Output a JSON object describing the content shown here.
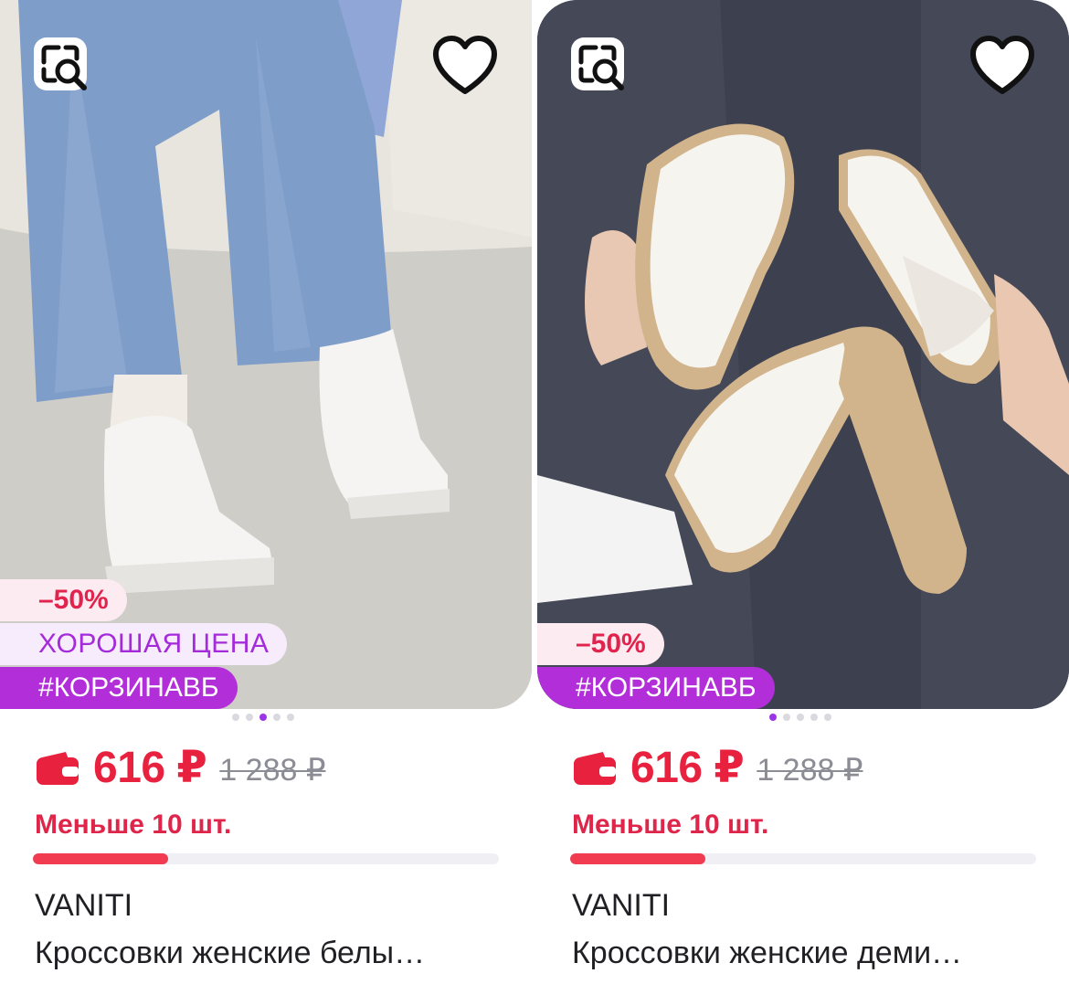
{
  "products": [
    {
      "discount": "–50%",
      "tags": [
        "ХОРОШАЯ ЦЕНА",
        "#КОРЗИНАВБ"
      ],
      "price": "616 ₽",
      "old_price": "1 288 ₽",
      "stock_text": "Меньше 10 шт.",
      "stock_level": 0.29,
      "brand": "VANITI",
      "title": "Кроссовки женские белы…",
      "carousel_active": 3,
      "carousel_count": 5,
      "icons": [
        "visual-search-icon",
        "heart-icon",
        "wallet-icon"
      ]
    },
    {
      "discount": "–50%",
      "tags": [
        "#КОРЗИНАВБ"
      ],
      "price": "616 ₽",
      "old_price": "1 288 ₽",
      "stock_text": "Меньше 10 шт.",
      "stock_level": 0.29,
      "brand": "VANITI",
      "title": "Кроссовки женские деми…",
      "carousel_active": 1,
      "carousel_count": 5,
      "icons": [
        "visual-search-icon",
        "heart-icon",
        "wallet-icon"
      ]
    }
  ],
  "colors": {
    "price": "#e8213f",
    "hashtag_bg": "#b22ed8",
    "good_price_text": "#a52ad9",
    "progress_fill": "#f03b51",
    "dot_active": "#9b36e6"
  }
}
